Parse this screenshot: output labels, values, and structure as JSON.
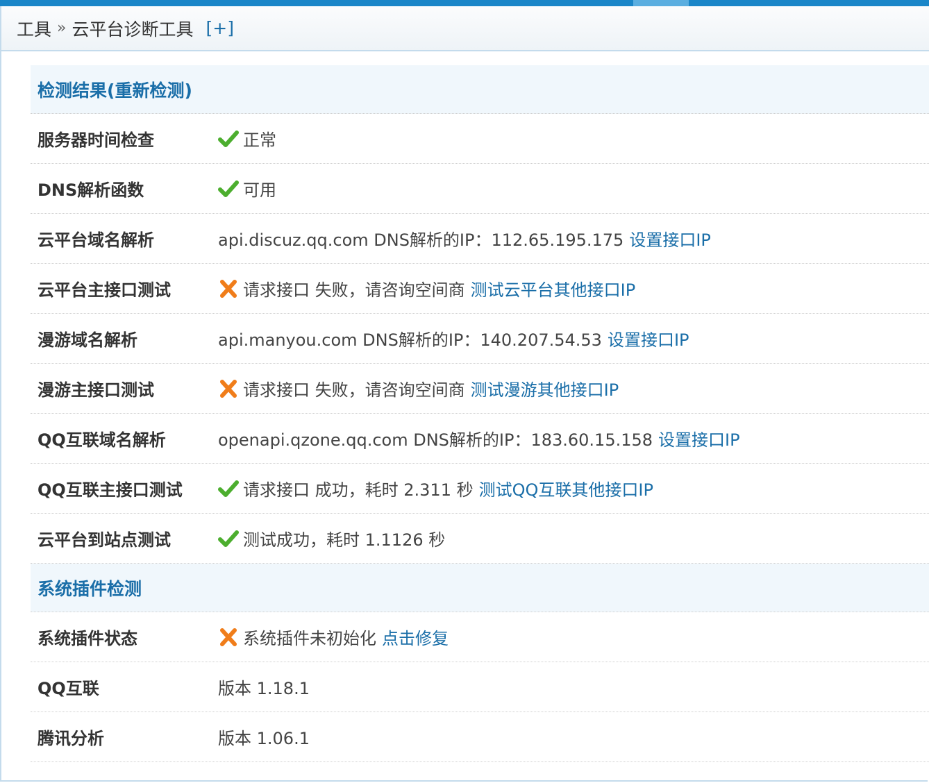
{
  "breadcrumb": {
    "parent": "工具",
    "separator": "»",
    "current": "云平台诊断工具",
    "add": "[+]"
  },
  "sections": [
    {
      "header": "检测结果",
      "header_link": "(重新检测)",
      "rows": [
        {
          "label": "服务器时间检查",
          "status": "ok",
          "text": "正常",
          "link": ""
        },
        {
          "label": "DNS解析函数",
          "status": "ok",
          "text": "可用",
          "link": ""
        },
        {
          "label": "云平台域名解析",
          "status": "none",
          "text": "api.discuz.qq.com DNS解析的IP：112.65.195.175",
          "link": "设置接口IP"
        },
        {
          "label": "云平台主接口测试",
          "status": "fail",
          "text": "请求接口 失败，请咨询空间商",
          "link": "测试云平台其他接口IP"
        },
        {
          "label": "漫游域名解析",
          "status": "none",
          "text": "api.manyou.com DNS解析的IP：140.207.54.53",
          "link": "设置接口IP"
        },
        {
          "label": "漫游主接口测试",
          "status": "fail",
          "text": "请求接口 失败，请咨询空间商",
          "link": "测试漫游其他接口IP"
        },
        {
          "label": "QQ互联域名解析",
          "status": "none",
          "text": "openapi.qzone.qq.com DNS解析的IP：183.60.15.158",
          "link": "设置接口IP"
        },
        {
          "label": "QQ互联主接口测试",
          "status": "ok",
          "text": "请求接口 成功，耗时 2.311 秒",
          "link": "测试QQ互联其他接口IP"
        },
        {
          "label": "云平台到站点测试",
          "status": "ok",
          "text": "测试成功，耗时 1.1126 秒",
          "link": ""
        }
      ]
    },
    {
      "header": "系统插件检测",
      "header_link": "",
      "rows": [
        {
          "label": "系统插件状态",
          "status": "fail",
          "text": "系统插件未初始化",
          "link": "点击修复"
        },
        {
          "label": "QQ互联",
          "status": "none",
          "text": "版本 1.18.1",
          "link": ""
        },
        {
          "label": "腾讯分析",
          "status": "none",
          "text": "版本 1.06.1",
          "link": ""
        }
      ]
    }
  ],
  "colors": {
    "ok": "#4cae2e",
    "fail": "#f07d1a",
    "link": "#1a6ea8"
  },
  "icons": {
    "ok": "checkmark-icon",
    "fail": "cross-icon"
  }
}
